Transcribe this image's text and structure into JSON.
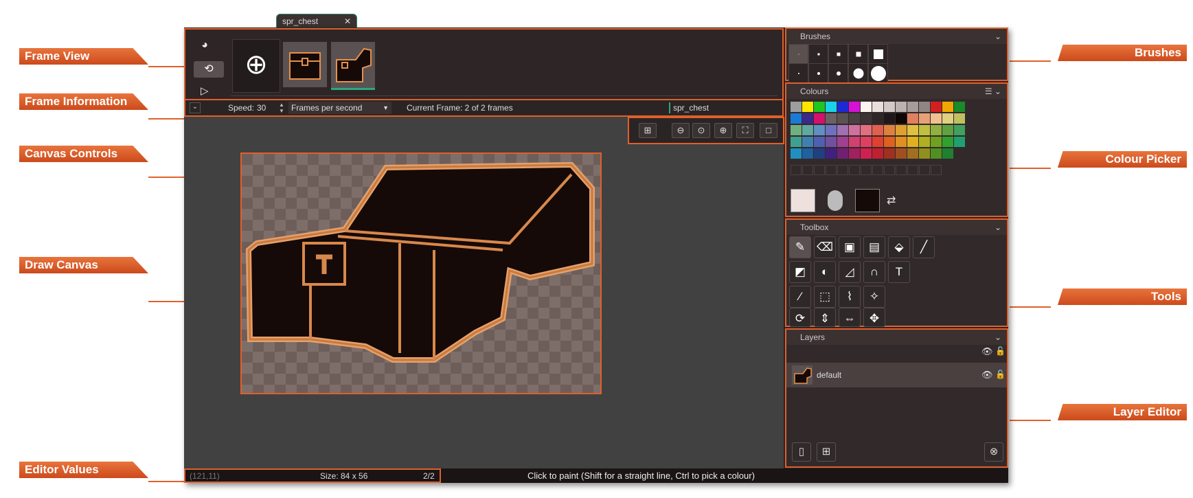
{
  "tab": {
    "title": "spr_chest",
    "close": "✕"
  },
  "callouts": {
    "frame_view": "Frame View",
    "frame_information": "Frame Information",
    "canvas_controls": "Canvas Controls",
    "draw_canvas": "Draw Canvas",
    "editor_values": "Editor Values",
    "brushes": "Brushes",
    "colour_picker": "Colour Picker",
    "tools": "Tools",
    "layer_editor": "Layer Editor"
  },
  "frame_info": {
    "speed_label": "Speed:",
    "speed_value": "30",
    "speed_unit": "Frames per second",
    "current_frame": "Current Frame: 2 of 2 frames",
    "sprite_name": "spr_chest"
  },
  "panels": {
    "brushes_title": "Brushes",
    "colours_title": "Colours",
    "toolbox_title": "Toolbox",
    "layers_title": "Layers"
  },
  "layers": [
    {
      "name": "default"
    }
  ],
  "status": {
    "coords": "(121,11)",
    "size": "Size: 84 x 56",
    "frame": "2/2",
    "hint": "Click to paint (Shift for a straight line, Ctrl to pick a colour)"
  },
  "icons": {
    "onion": "onion-skin-icon",
    "loop": "loop-icon",
    "play": "play-icon",
    "add": "add-frame-icon",
    "grid": "grid-icon",
    "zoom_out": "zoom-out-icon",
    "zoom_reset": "zoom-reset-icon",
    "zoom_in": "zoom-in-icon",
    "fit": "fit-icon",
    "eye": "eye-icon",
    "lock": "lock-icon"
  },
  "colours": {
    "accent": "#e0602c",
    "primary": "#ede0dd",
    "secondary": "#150a08",
    "palette": [
      [
        "#9e9e9e",
        "#ffe600",
        "#1fc71f",
        "#1ad3e6",
        "#1a2bd6",
        "#d611d6",
        "#fff4f0",
        "#e8e0dc",
        "#d2cac6",
        "#bbb3b0",
        "#a59d9a",
        "#8e8784",
        "#d22020",
        "#f0a800",
        "#1a8a2a"
      ],
      [
        "#1a7ad6",
        "#3b2a8a",
        "#d6116d",
        "#6a6262",
        "#5a5252",
        "#4a4242",
        "#3c3434",
        "#2e2626",
        "#201818",
        "#0e0706",
        "#e08060",
        "#e8a078",
        "#f0c090",
        "#e0d080",
        "#c0c060"
      ],
      [
        "#70b080",
        "#60a8a0",
        "#6090c0",
        "#7070c0",
        "#a070b0",
        "#d070a0",
        "#e07080",
        "#e06050",
        "#e08040",
        "#e0a030",
        "#e0c040",
        "#c0c040",
        "#90b040",
        "#60a040",
        "#40a060"
      ],
      [
        "#40a090",
        "#4080b0",
        "#5060b0",
        "#7050a0",
        "#a04090",
        "#d04070",
        "#e04060",
        "#e04030",
        "#e06020",
        "#e09020",
        "#e0b020",
        "#b0b020",
        "#70a020",
        "#30a030",
        "#20a070"
      ],
      [
        "#2090c0",
        "#2060a0",
        "#204080",
        "#402080",
        "#702070",
        "#a02060",
        "#d02050",
        "#c02030",
        "#a03020",
        "#a05020",
        "#a07020",
        "#909020",
        "#509020",
        "#208030"
      ]
    ]
  }
}
